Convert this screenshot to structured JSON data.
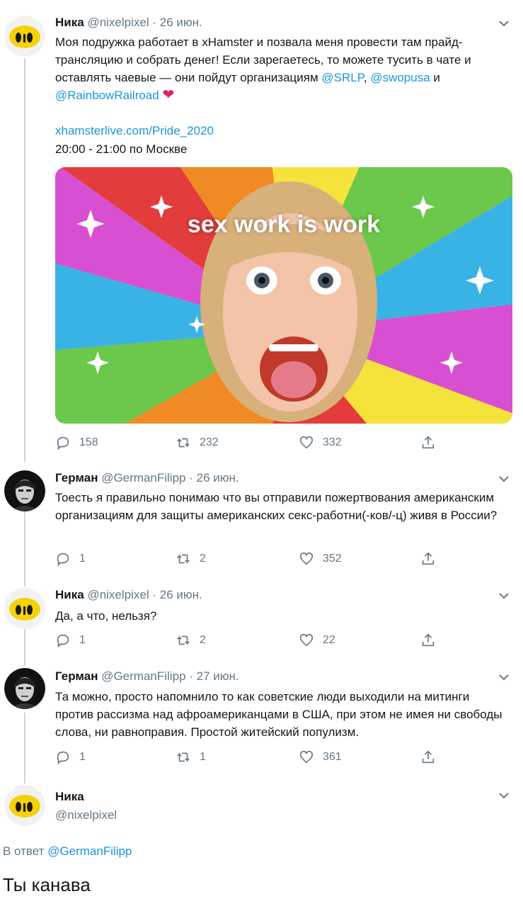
{
  "tweets": [
    {
      "name": "Ника",
      "handle": "@nixelpixel",
      "date": "· 26 июн.",
      "text_1": "Моя подружка работает в xHamster и позвала меня провести там прайд-трансляцию и собрать денег! Если зарегаетесь, то можете тусить в чате и оставлять чаевые — они пойдут организациям ",
      "mention_1": "@SRLP",
      "sep_1": ", ",
      "mention_2": "@swopusa",
      "sep_2": " и ",
      "mention_3": "@RainbowRailroad",
      "link": "xhamsterlive.com/Pride_2020",
      "time_line": "20:00 - 21:00 по Москве",
      "media_caption": "sex work is work",
      "replies": "158",
      "retweets": "232",
      "likes": "332"
    },
    {
      "name": "Герман",
      "handle": "@GermanFilipp",
      "date": "· 26 июн.",
      "text": "Тоесть я правильно понимаю что вы отправили пожертвования американским организациям для защиты американских секс-работни(-ков/-ц) живя в России?",
      "replies": "1",
      "retweets": "2",
      "likes": "352"
    },
    {
      "name": "Ника",
      "handle": "@nixelpixel",
      "date": "· 26 июн.",
      "text": "Да, а что, нельзя?",
      "replies": "1",
      "retweets": "2",
      "likes": "22"
    },
    {
      "name": "Герман",
      "handle": "@GermanFilipp",
      "date": "· 27 июн.",
      "text": "Та можно, просто напомнило то как советские люди выходили на митинги против рассизма над афроамериканцами в США, при этом не имея ни свободы слова, ни равноправия. Простой житейский популизм.",
      "replies": "1",
      "retweets": "1",
      "likes": "361"
    }
  ],
  "main_tweet": {
    "name": "Ника",
    "handle": "@nixelpixel",
    "reply_prefix": "В ответ ",
    "reply_mention": "@GermanFilipp",
    "text": "Ты канава"
  },
  "colors": {
    "accent": "#1b95e0",
    "muted": "#657786",
    "like": "#e0245e",
    "thread": "#ccd6dd"
  }
}
